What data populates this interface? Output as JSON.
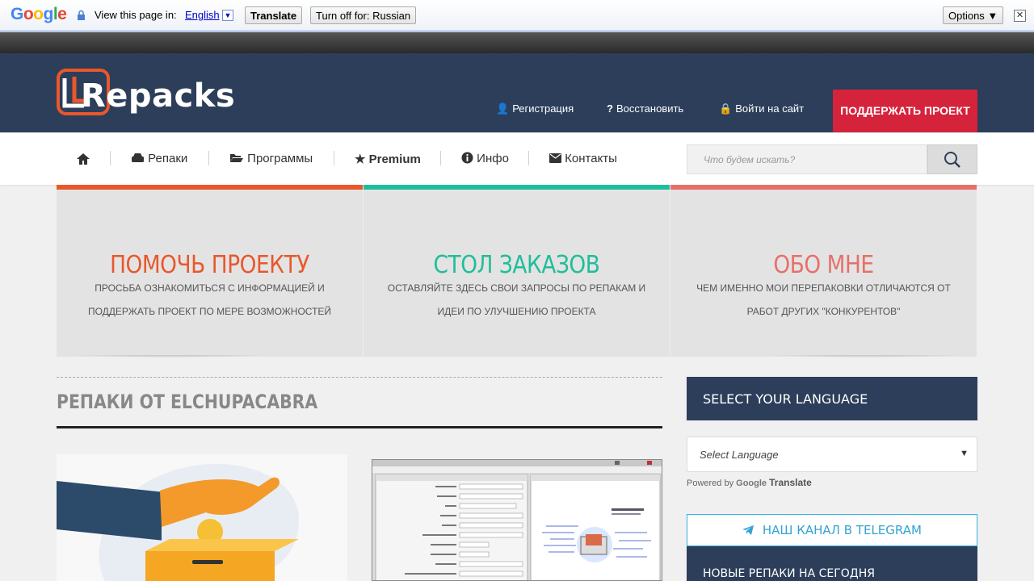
{
  "translate_bar": {
    "logo": "Google",
    "view_label": "View this page in:",
    "language": "English",
    "translate_button": "Translate",
    "turnoff_button": "Turn off for: Russian",
    "options_button": "Options ▼"
  },
  "header": {
    "logo_text": "Repacks",
    "register": "Регистрация",
    "restore": "Восстановить",
    "login": "Войти на сайт",
    "support_button": "ПОДДЕРЖАТЬ ПРОЕКТ"
  },
  "nav": {
    "items": [
      "Репаки",
      "Программы",
      "Premium",
      "Инфо",
      "Контакты"
    ],
    "search_placeholder": "Что будем искать?"
  },
  "cards": [
    {
      "title": "ПОМОЧЬ ПРОЕКТУ",
      "text": "ПРОСЬБА ОЗНАКОМИТЬСЯ С ИНФОРМАЦИЕЙ И ПОДДЕРЖАТЬ ПРОЕКТ ПО МЕРЕ ВОЗМОЖНОСТЕЙ",
      "color": "#e8582b"
    },
    {
      "title": "СТОЛ ЗАКАЗОВ",
      "text": "ОСТАВЛЯЙТЕ ЗДЕСЬ СВОИ ЗАПРОСЫ ПО РЕПАКАМ И ИДЕИ ПО УЛУЧШЕНИЮ ПРОЕКТА",
      "color": "#1fbe9a"
    },
    {
      "title": "ОБО МНЕ",
      "text": "ЧЕМ ИМЕННО МОИ ПЕРЕПАКОВКИ ОТЛИЧАЮТСЯ ОТ РАБОТ ДРУГИХ \"КОНКУРЕНТОВ\"",
      "color": "#e5706a"
    }
  ],
  "main": {
    "section_title": "РЕПАКИ ОТ ELCHUPACABRA"
  },
  "sidebar": {
    "language_heading": "SELECT YOUR LANGUAGE",
    "select_placeholder": "Select Language",
    "powered_by": "Powered by",
    "google": "Google",
    "translate": "Translate",
    "telegram": "НАШ КАНАЛ В TELEGRAM",
    "new_repacks": "НОВЫЕ РЕПАКИ НА СЕГОДНЯ"
  }
}
